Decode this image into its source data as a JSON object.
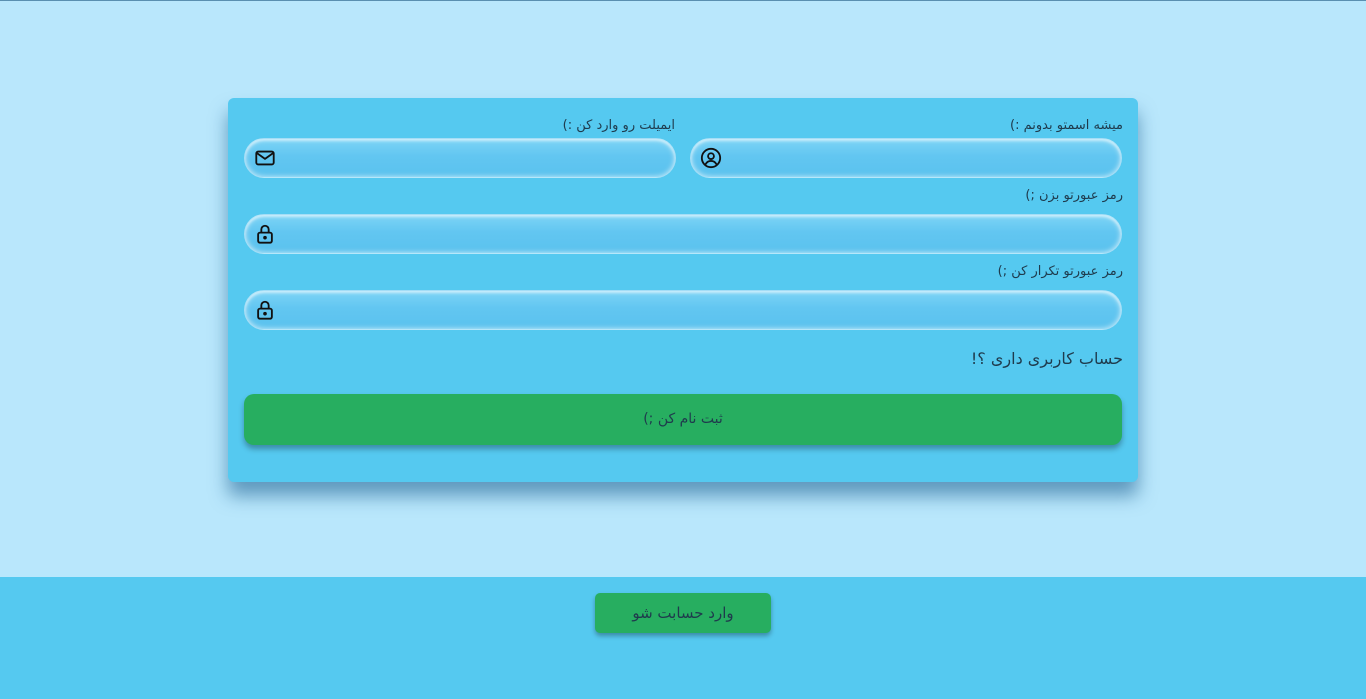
{
  "form": {
    "name_label": "میشه اسمتو بدونم :)",
    "name_value": "",
    "name_icon": "user-circle-icon",
    "email_label": "ایمیلت رو وارد کن :)",
    "email_value": "",
    "email_icon": "envelope-icon",
    "password_label": "رمز عبورتو بزن ;)",
    "password_value": "",
    "password_icon": "lock-icon",
    "confirm_label": "رمز عبورتو تکرار کن ;)",
    "confirm_value": "",
    "confirm_icon": "lock-icon",
    "have_account": "حساب کاربری داری ؟!",
    "submit_label": "ثبت نام کن ;)"
  },
  "footer": {
    "login_label": "وارد حسابت شو"
  },
  "colors": {
    "page_background": "#b9e7fc",
    "card_background": "#55c9f0",
    "button_green": "#27ae60",
    "text_dark": "#1f3b4d"
  }
}
